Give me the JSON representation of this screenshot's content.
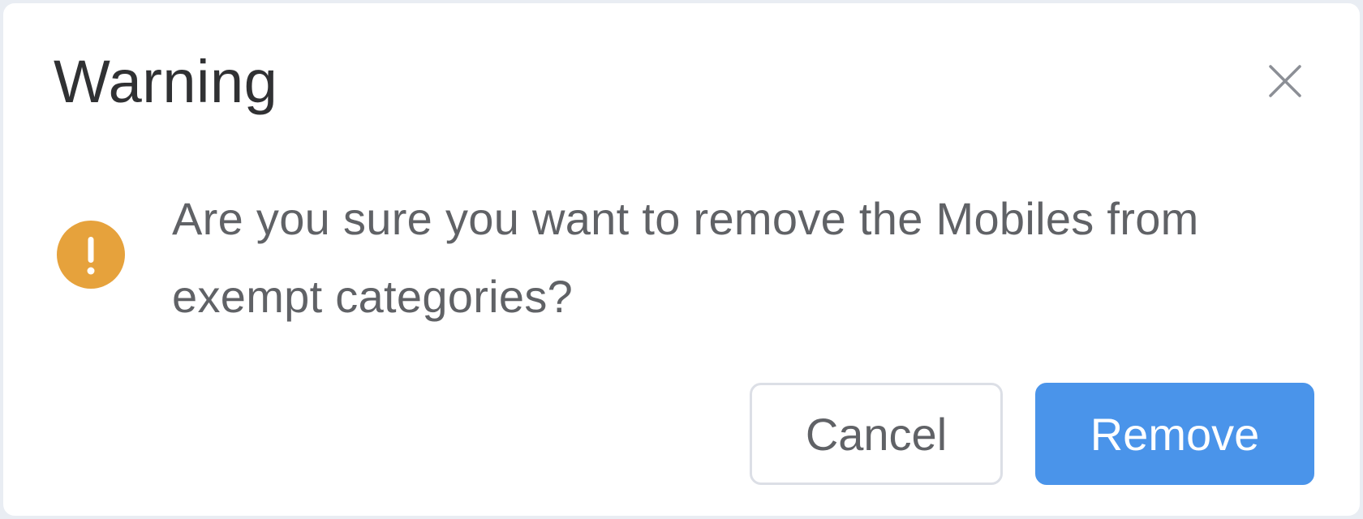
{
  "dialog": {
    "title": "Warning",
    "message": "Are you sure you want to remove the Mobiles from exempt categories?",
    "icon": "warning-icon",
    "close_icon": "close-icon",
    "buttons": {
      "cancel_label": "Cancel",
      "confirm_label": "Remove"
    }
  },
  "colors": {
    "warning": "#e6a23c",
    "primary": "#4a94ea",
    "title_text": "#303133",
    "body_text": "#606266",
    "border": "#dcdfe6"
  }
}
